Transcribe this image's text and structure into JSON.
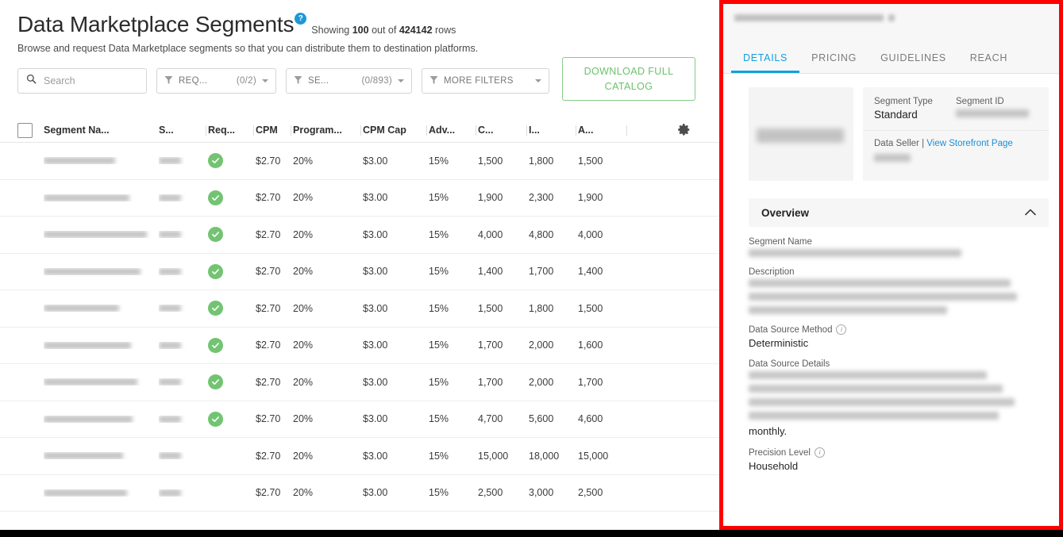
{
  "header": {
    "title": "Data Marketplace Segments",
    "help_icon": "help-icon",
    "help_glyph": "?",
    "showing_prefix": "Showing ",
    "showing_count": "100",
    "showing_mid": " out of ",
    "showing_total": "424142",
    "showing_suffix": " rows",
    "subtitle": "Browse and request Data Marketplace segments so that you can distribute them to destination platforms."
  },
  "toolbar": {
    "search_placeholder": "Search",
    "search_value": "",
    "search_icon": "search-icon",
    "filters": [
      {
        "label": "REQ...",
        "count": "(0/2)",
        "icon": "funnel-icon"
      },
      {
        "label": "SE...",
        "count": "(0/893)",
        "icon": "funnel-icon"
      },
      {
        "label": "MORE FILTERS",
        "count": "",
        "icon": "funnel-icon"
      }
    ],
    "download_line1": "DOWNLOAD FULL",
    "download_line2": "CATALOG",
    "download_color": "#6cc06c",
    "settings_icon": "gear-icon"
  },
  "table": {
    "select_all_checkbox": "unchecked",
    "columns": [
      "Segment Na...",
      "S...",
      "Req...",
      "CPM",
      "Program...",
      "CPM Cap",
      "Adv...",
      "C...",
      "I...",
      "A..."
    ],
    "rows": [
      {
        "name": "redacted",
        "seller": "redacted",
        "requestable": true,
        "cpm": "$2.70",
        "programmatic": "20%",
        "cpm_cap": "$3.00",
        "adv": "15%",
        "c": "1,500",
        "i": "1,800",
        "a": "1,500"
      },
      {
        "name": "redacted",
        "seller": "redacted",
        "requestable": true,
        "cpm": "$2.70",
        "programmatic": "20%",
        "cpm_cap": "$3.00",
        "adv": "15%",
        "c": "1,900",
        "i": "2,300",
        "a": "1,900"
      },
      {
        "name": "redacted",
        "seller": "redacted",
        "requestable": true,
        "cpm": "$2.70",
        "programmatic": "20%",
        "cpm_cap": "$3.00",
        "adv": "15%",
        "c": "4,000",
        "i": "4,800",
        "a": "4,000"
      },
      {
        "name": "redacted",
        "seller": "redacted",
        "requestable": true,
        "cpm": "$2.70",
        "programmatic": "20%",
        "cpm_cap": "$3.00",
        "adv": "15%",
        "c": "1,400",
        "i": "1,700",
        "a": "1,400"
      },
      {
        "name": "redacted",
        "seller": "redacted",
        "requestable": true,
        "cpm": "$2.70",
        "programmatic": "20%",
        "cpm_cap": "$3.00",
        "adv": "15%",
        "c": "1,500",
        "i": "1,800",
        "a": "1,500"
      },
      {
        "name": "redacted",
        "seller": "redacted",
        "requestable": true,
        "cpm": "$2.70",
        "programmatic": "20%",
        "cpm_cap": "$3.00",
        "adv": "15%",
        "c": "1,700",
        "i": "2,000",
        "a": "1,600"
      },
      {
        "name": "redacted",
        "seller": "redacted",
        "requestable": true,
        "cpm": "$2.70",
        "programmatic": "20%",
        "cpm_cap": "$3.00",
        "adv": "15%",
        "c": "1,700",
        "i": "2,000",
        "a": "1,700"
      },
      {
        "name": "redacted",
        "seller": "redacted",
        "requestable": true,
        "cpm": "$2.70",
        "programmatic": "20%",
        "cpm_cap": "$3.00",
        "adv": "15%",
        "c": "4,700",
        "i": "5,600",
        "a": "4,600"
      },
      {
        "name": "redacted",
        "seller": "redacted",
        "requestable": false,
        "cpm": "$2.70",
        "programmatic": "20%",
        "cpm_cap": "$3.00",
        "adv": "15%",
        "c": "15,000",
        "i": "18,000",
        "a": "15,000"
      },
      {
        "name": "redacted",
        "seller": "redacted",
        "requestable": false,
        "cpm": "$2.70",
        "programmatic": "20%",
        "cpm_cap": "$3.00",
        "adv": "15%",
        "c": "2,500",
        "i": "3,000",
        "a": "2,500"
      }
    ]
  },
  "panel": {
    "chip_label": "redacted",
    "chip_close_icon": "close-icon",
    "tabs": [
      {
        "label": "DETAILS",
        "active": true
      },
      {
        "label": "PRICING",
        "active": false
      },
      {
        "label": "GUIDELINES",
        "active": false
      },
      {
        "label": "REACH",
        "active": false
      }
    ],
    "active_tab_color": "#12a0dd",
    "thumbnail": "redacted-logo",
    "meta": {
      "segment_type_label": "Segment Type",
      "segment_type_value": "Standard",
      "segment_id_label": "Segment ID",
      "segment_id_value": "redacted",
      "data_seller_label": "Data Seller",
      "data_seller_sep": "|",
      "storefront_link": "View Storefront Page",
      "data_seller_value": "redacted"
    },
    "overview": {
      "title": "Overview",
      "collapse_icon": "chevron-up-icon",
      "fields": [
        {
          "label": "Segment Name",
          "value": "redacted",
          "blurred": true,
          "lines": 1,
          "info": false
        },
        {
          "label": "Description",
          "value": "redacted",
          "blurred": true,
          "lines": 3,
          "info": false
        },
        {
          "label": "Data Source Method",
          "value": "Deterministic",
          "blurred": false,
          "lines": 0,
          "info": true
        },
        {
          "label": "Data Source Details",
          "value": "monthly.",
          "blurred": true,
          "lines": 4,
          "info": false
        },
        {
          "label": "Precision Level",
          "value": "Household",
          "blurred": false,
          "lines": 0,
          "info": true
        }
      ]
    }
  },
  "annotation": {
    "highlight_color": "#ff0000",
    "bottom_bar_color": "#000000"
  }
}
